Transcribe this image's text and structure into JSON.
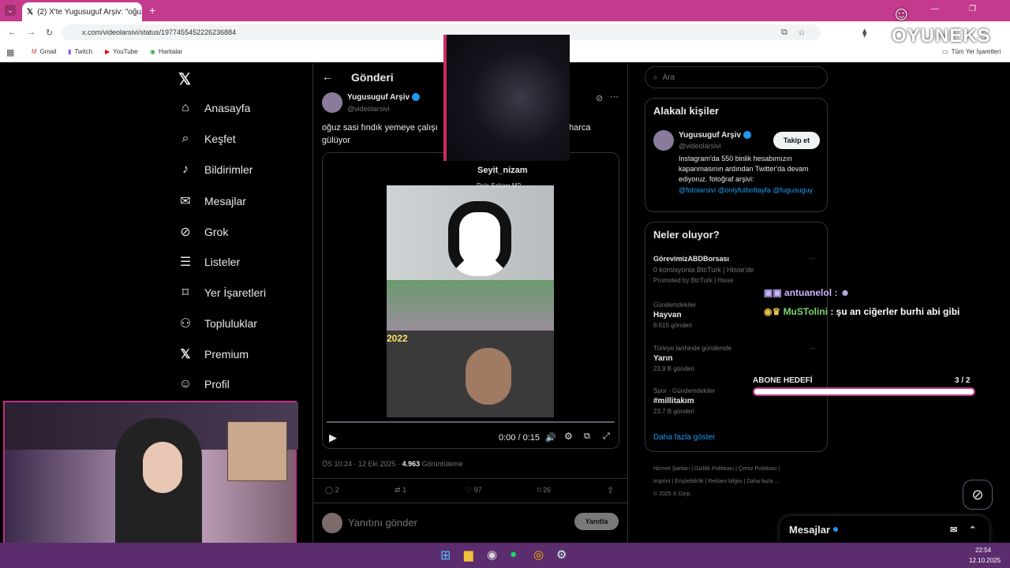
{
  "browser": {
    "tab_title": "(2) X'te Yugusuguf Arşiv: \"oğuz",
    "url": "x.com/videolarsivi/status/1977455452226236884",
    "bookmarks": [
      "Gmail",
      "Twitch",
      "YouTube",
      "Haritalar"
    ],
    "all_bookmarks": "Tüm Yer İşaretleri"
  },
  "left_nav": {
    "items": [
      "Anasayfa",
      "Keşfet",
      "Bildirimler",
      "Mesajlar",
      "Grok",
      "Listeler",
      "Yer İşaretleri",
      "Topluluklar",
      "Premium",
      "Profil"
    ]
  },
  "post": {
    "header": "Gönderi",
    "author_name": "Yugusuguf Arşiv",
    "author_handle": "@videolarsivi",
    "text_line1": "oğuz sasi fındık yemeye çalışı",
    "text_line1_end": "harca",
    "text_line2": "gülüyor",
    "video_overlay_name": "Seyit_nizam",
    "video_overlay_sub": "Reis Şakacı M?",
    "video_year": "2022",
    "time": "0:00 / 0:15",
    "meta_time": "ÖS 10:24 · 12 Eki 2025 · ",
    "views": "4.963",
    "views_label": " Görüntüleme",
    "replies": "2",
    "reposts": "1",
    "likes": "97",
    "bookmarks": "26",
    "reply_placeholder": "Yanıtını gönder",
    "reply_button": "Yanıtla"
  },
  "search": {
    "placeholder": "Ara"
  },
  "related": {
    "title": "Alakalı kişiler",
    "name": "Yugusuguf Arşiv",
    "handle": "@videolarsivi",
    "follow": "Takip et",
    "bio": "Instagram'da 550 binlik hesabımızın kapanmasının ardından Twitter'da devam ediyoruz. fotoğraf arşivi:",
    "links": "@fotolarsivi @onlyfutboltayfa @fugusuguy"
  },
  "trends": {
    "title": "Neler oluyor?",
    "items": [
      {
        "context": "",
        "name": "GörevimizABDBorsası",
        "sub": "0 komisyonla BtcTurk | Hisse'de",
        "count": "Promoted by BtcTurk | Hisse"
      },
      {
        "context": "Gündemdekiler",
        "name": "Hayvan",
        "count": "8.615 gönderi"
      },
      {
        "context": "Türkiye tarihinde gündemde",
        "name": "Yarın",
        "count": "23,9 B gönderi"
      },
      {
        "context": "Spor · Gündemdekiler",
        "name": "#millitakım",
        "count": "23,7 B gönderi"
      }
    ],
    "show_more": "Daha fazla göster"
  },
  "footer_links": [
    "Hizmet Şartları",
    "Gizlilik Politikası",
    "Çerez Politikası",
    "Imprint",
    "Erişilebilirlik",
    "Reklam bilgisi",
    "Daha fazla ...",
    "© 2025 X Corp."
  ],
  "messages_drawer": "Mesajlar",
  "stream_overlay": {
    "brand": "OYUNEKS",
    "chat": [
      {
        "user": "antuanelol",
        "msg": ""
      },
      {
        "user": "MuSTolini",
        "msg": "şu an ciğerler burhi abi gibi"
      }
    ],
    "sub_goal_label": "ABONE HEDEFİ",
    "sub_goal_value": "3 / 2",
    "sub_goal_progress": 1.0
  },
  "taskbar": {
    "time": "22:54",
    "date": "12.10.2025"
  }
}
